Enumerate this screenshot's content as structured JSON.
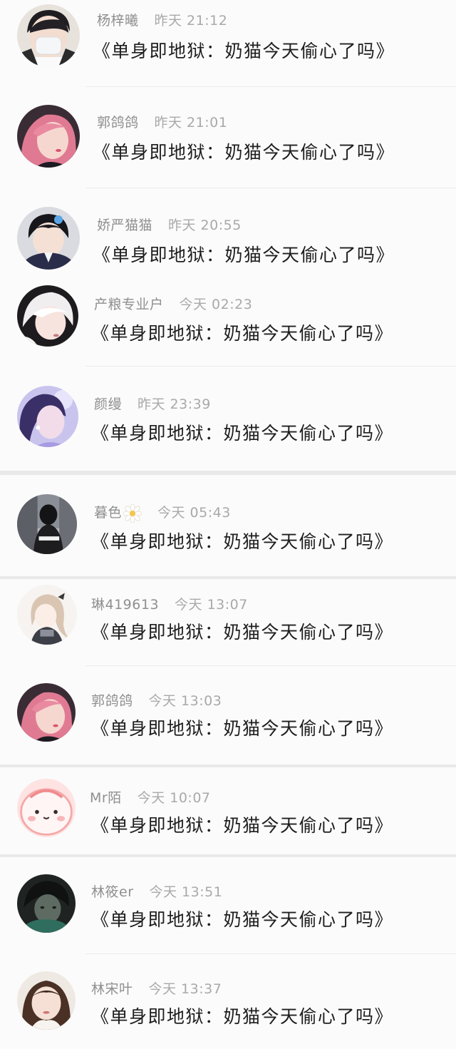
{
  "messages": [
    {
      "name": "杨梓曦",
      "time": "昨天 21:12",
      "text": "《单身即地狱：奶猫今天偷心了吗》",
      "avatar": "masked-boy-avatar"
    },
    {
      "name": "郭鸽鸽",
      "time": "昨天 21:01",
      "text": "《单身即地狱：奶猫今天偷心了吗》",
      "avatar": "pink-hair-girl-avatar"
    },
    {
      "name": "娇严猫猫",
      "time": "昨天 20:55",
      "text": "《单身即地狱：奶猫今天偷心了吗》",
      "avatar": "uniform-boy-avatar"
    },
    {
      "name": "产粮专业户",
      "time": "今天 02:23",
      "text": "《单身即地狱：奶猫今天偷心了吗》",
      "avatar": "white-hair-boy-avatar"
    },
    {
      "name": "颜缦",
      "time": "昨天 23:39",
      "text": "《单身即地狱：奶猫今天偷心了吗》",
      "avatar": "purple-girl-avatar"
    },
    {
      "name": "暮色",
      "time": "今天 05:43",
      "text": "《单身即地狱：奶猫今天偷心了吗》",
      "avatar": "window-silhouette-avatar"
    },
    {
      "name": "琳419613",
      "time": "今天 13:07",
      "text": "《单身即地狱：奶猫今天偷心了吗》",
      "avatar": "anime-girl-avatar"
    },
    {
      "name": "郭鸽鸽",
      "time": "今天 13:03",
      "text": "《单身即地狱：奶猫今天偷心了吗》",
      "avatar": "pink-hair-girl-avatar"
    },
    {
      "name": "Mr陌",
      "time": "今天 10:07",
      "text": "《单身即地狱：奶猫今天偷心了吗》",
      "avatar": "cute-peach-avatar"
    },
    {
      "name": "林筱er",
      "time": "今天 13:51",
      "text": "《单身即地狱：奶猫今天偷心了吗》",
      "avatar": "dark-boy-avatar"
    },
    {
      "name": "林宋叶",
      "time": "今天 13:37",
      "text": "《单身即地狱：奶猫今天偷心了吗》",
      "avatar": "brown-hair-girl-avatar"
    }
  ],
  "colors": {
    "name_text": "#8f8f8f",
    "time_text": "#a9a9a9",
    "message_text": "#1e1e1e",
    "background": "#fbfbfb"
  }
}
